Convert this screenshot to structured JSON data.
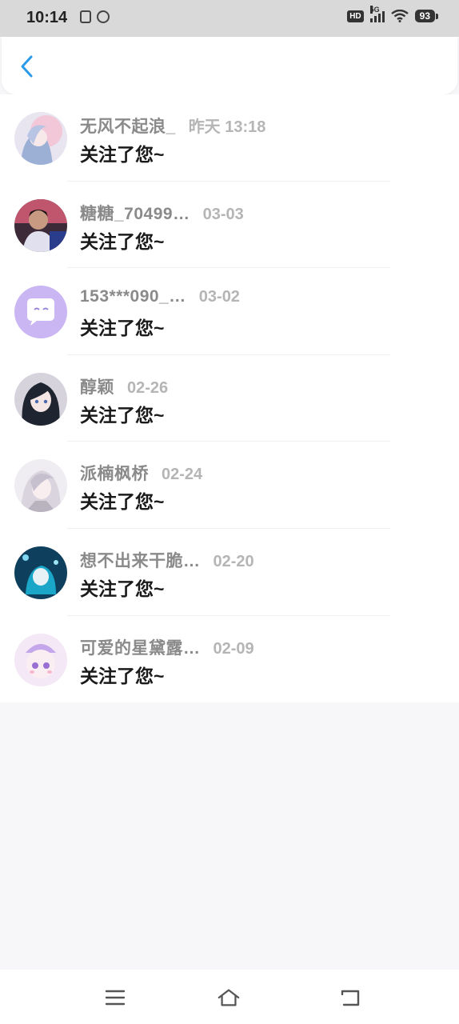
{
  "status_bar": {
    "time": "10:14",
    "network": "5G",
    "hd": "HD",
    "battery": "93"
  },
  "nav": {
    "back_icon": "chevron-left-icon",
    "accent_color": "#2a9bea"
  },
  "followers": [
    {
      "name": "无风不起浪_",
      "time": "昨天 13:18",
      "message": "关注了您~"
    },
    {
      "name": "糖糖_70499…",
      "time": "03-03",
      "message": "关注了您~"
    },
    {
      "name": "153***090_…",
      "time": "03-02",
      "message": "关注了您~"
    },
    {
      "name": "醇颖",
      "time": "02-26",
      "message": "关注了您~"
    },
    {
      "name": "派楠枫桥",
      "time": "02-24",
      "message": "关注了您~"
    },
    {
      "name": "想不出来干脆…",
      "time": "02-20",
      "message": "关注了您~"
    },
    {
      "name": "可爱的星黛露…",
      "time": "02-09",
      "message": "关注了您~"
    }
  ],
  "system_nav": {
    "menu_icon": "menu-icon",
    "home_icon": "home-icon",
    "back_icon": "back-icon"
  }
}
